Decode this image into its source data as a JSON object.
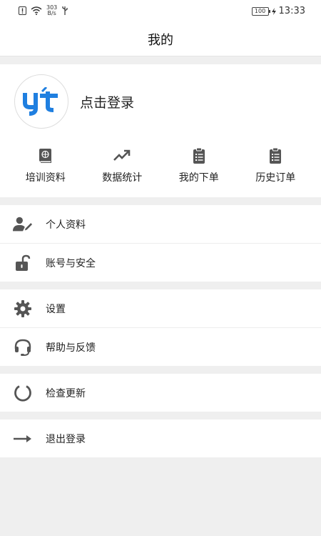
{
  "status": {
    "net_speed_top": "303",
    "net_speed_bottom": "B/s",
    "battery": "100",
    "time": "13:33"
  },
  "header": {
    "title": "我的"
  },
  "profile": {
    "login_text": "点击登录",
    "logo_letters": "yt"
  },
  "quick_actions": [
    {
      "label": "培训资料",
      "icon": "book-icon"
    },
    {
      "label": "数据统计",
      "icon": "trending-up-icon"
    },
    {
      "label": "我的下单",
      "icon": "clipboard-list-icon"
    },
    {
      "label": "历史订单",
      "icon": "clipboard-list-icon"
    }
  ],
  "menu": {
    "personal_info": "个人资料",
    "account_security": "账号与安全",
    "settings": "设置",
    "help_feedback": "帮助与反馈",
    "check_update": "检查更新",
    "logout": "退出登录"
  },
  "colors": {
    "brand_blue": "#1f7fe0",
    "icon_gray": "#555555"
  }
}
